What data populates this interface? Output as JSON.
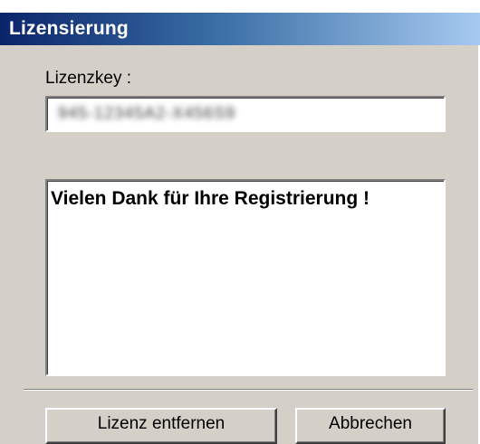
{
  "window": {
    "title": "Lizensierung"
  },
  "license": {
    "key_label": "Lizenzkey :",
    "key_value": "945-12345A2-X456S9"
  },
  "message": {
    "text": "Vielen Dank für Ihre Registrierung !"
  },
  "buttons": {
    "remove_label": "Lizenz entfernen",
    "cancel_label": "Abbrechen"
  },
  "colors": {
    "titlebar_start": "#0a246a",
    "titlebar_end": "#a6caf0",
    "dialog_bg": "#d4d0c8"
  }
}
